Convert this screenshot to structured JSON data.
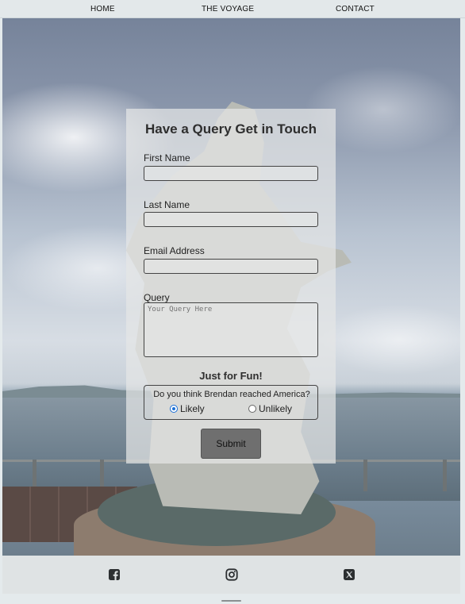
{
  "nav": {
    "items": [
      "HOME",
      "THE VOYAGE",
      "CONTACT"
    ]
  },
  "form": {
    "title": "Have a Query Get in Touch",
    "first_name_label": "First Name",
    "last_name_label": "Last Name",
    "email_label": "Email Address",
    "query_label": "Query",
    "query_placeholder": "Your Query Here",
    "fun_title": "Just for Fun!",
    "question": "Do you think Brendan reached America?",
    "options": [
      "Likely",
      "Unlikely"
    ],
    "selected_option": "Likely",
    "submit_label": "Submit"
  },
  "footer": {
    "icons": [
      "facebook-icon",
      "instagram-icon",
      "x-icon"
    ]
  },
  "colors": {
    "nav_bg": "#e3e8ea",
    "radio_accent": "#1a6fd6",
    "submit_bg": "#6f6f6f"
  }
}
